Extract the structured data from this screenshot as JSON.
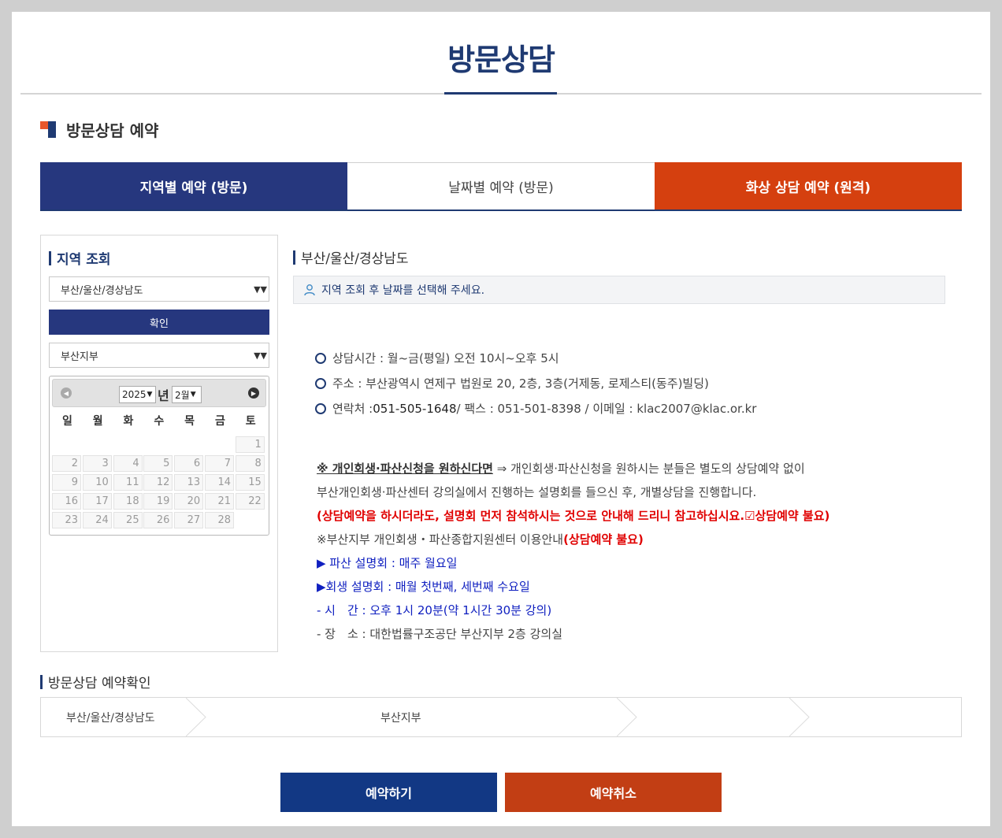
{
  "page": {
    "title": "방문상담"
  },
  "section": {
    "title": "방문상담 예약"
  },
  "tabs": [
    {
      "label": "지역별 예약 (방문)"
    },
    {
      "label": "날짜별 예약 (방문)"
    },
    {
      "label": "화상 상담 예약 (원격)"
    }
  ],
  "region_lookup": {
    "title": "지역 조회",
    "region_select": "부산/울산/경상남도",
    "confirm_button": "확인",
    "branch_select": "부산지부"
  },
  "calendar": {
    "year": "2025",
    "year_suffix": "년",
    "month": "2월",
    "weekdays": [
      "일",
      "월",
      "화",
      "수",
      "목",
      "금",
      "토"
    ],
    "days": [
      "1",
      "2",
      "3",
      "4",
      "5",
      "6",
      "7",
      "8",
      "9",
      "10",
      "11",
      "12",
      "13",
      "14",
      "15",
      "16",
      "17",
      "18",
      "19",
      "20",
      "21",
      "22",
      "23",
      "24",
      "25",
      "26",
      "27",
      "28"
    ]
  },
  "detail": {
    "region_title": "부산/울산/경상남도",
    "notice": "지역 조회 후 날짜를 선택해 주세요.",
    "hours": "상담시간 : 월~금(평일) 오전 10시~오후 5시",
    "address": "주소 : 부산광역시 연제구 법원로 20, 2층, 3층(거제동, 로제스티(동주)빌딩)",
    "contact_label": "연락처 : ",
    "phone": "051-505-1648",
    "contact_rest": " / 팩스 : 051-501-8398 / 이메일 : klac2007@klac.or.kr",
    "bankruptcy_heading": "※ 개인회생·파산신청을 원하신다면",
    "bankruptcy_line1": " ⇒ 개인회생·파산신청을 원하시는 분들은 별도의 상담예약 없이",
    "bankruptcy_line2": "부산개인회생·파산센터 강의실에서 진행하는 설명회를 들으신 후, 개별상담을 진행합니다.",
    "bankruptcy_warning": "(상담예약을 하시더라도, 설명회 먼저 참석하시는 것으로 안내해 드리니 참고하십시요.☑상담예약 불요)",
    "center_info": "※부산지부 개인회생・파산종합지원센터 이용안내",
    "center_info_red": "(상담예약 불요)",
    "bankruptcy_session": "▶ 파산 설명회 : 매주 월요일",
    "rehab_session": "▶회생 설명회 : 매월 첫번째, 세번째 수요일",
    "time": "- 시　간 : 오후 1시 20분(약 1시간 30분 강의)",
    "place": "- 장　소 : 대한법률구조공단 부산지부 2층 강의실"
  },
  "confirmation": {
    "title": "방문상담 예약확인",
    "steps": [
      "부산/울산/경상남도",
      "부산지부",
      "",
      ""
    ]
  },
  "actions": {
    "reserve": "예약하기",
    "cancel": "예약취소"
  },
  "colors": {
    "navy": "#1f3a72",
    "tab_navy": "#26377e",
    "orange": "#d5400f",
    "reserve": "#123884",
    "cancel": "#c23e14"
  }
}
